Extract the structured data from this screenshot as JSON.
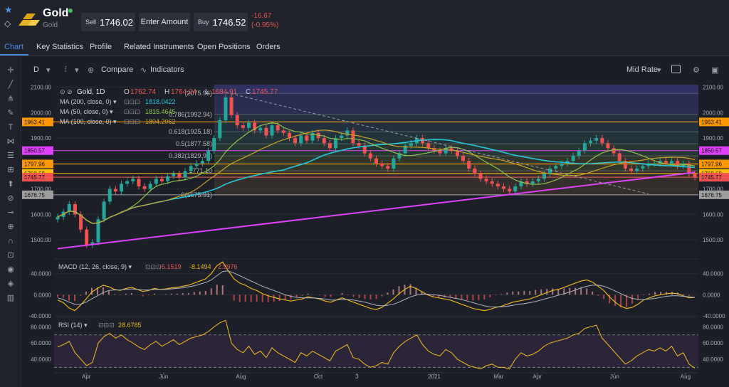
{
  "header": {
    "title": "Gold",
    "subtitle": "Gold",
    "sell_label": "Sell",
    "sell_price": "1746.02",
    "enter_amount": "Enter Amount",
    "buy_label": "Buy",
    "buy_price": "1746.52",
    "change_abs": "-16.67",
    "change_pct": "(-0.95%)"
  },
  "tabs": [
    "Chart",
    "Key Statistics",
    "Profile",
    "Related Instruments",
    "Open Positions",
    "Orders"
  ],
  "toolbar": {
    "interval": "D",
    "compare": "Compare",
    "indicators": "Indicators",
    "price_mode": "Mid Rate"
  },
  "colors": {
    "up": "#26a69a",
    "down": "#ef5350",
    "ma200": "#26c6da",
    "ma50": "#8bc34a",
    "ma100": "#c9a227",
    "trend": "#e040fb",
    "fib": "#ffffff",
    "orange_line": "#ff9800"
  },
  "chart_data": [
    {
      "type": "line",
      "title": "Gold, 1D",
      "ohlc": {
        "O": "1762.74",
        "H": "1764.24",
        "L": "1684.91",
        "C": "1745.77"
      },
      "ma": [
        {
          "name": "MA (200, close, 0)",
          "value": "1818.0422"
        },
        {
          "name": "MA (50, close, 0)",
          "value": "1815.4645"
        },
        {
          "name": "MA (100, close, 0)",
          "value": "1804.2062"
        }
      ],
      "x_ticks": [
        "Apr",
        "Jun",
        "Aug",
        "Oct",
        "3",
        "2021",
        "Mar",
        "Apr",
        "Jun",
        "Aug"
      ],
      "y_ticks": [
        "2100.00",
        "2000.00",
        "1900.00",
        "1800.00",
        "1700.00",
        "1600.00",
        "1500.00"
      ],
      "ylim": [
        1430,
        2110
      ],
      "level_labels": [
        {
          "text": "1963.41",
          "value": 1963.41,
          "color": "#ff9800"
        },
        {
          "text": "1850.57",
          "value": 1850.57,
          "color": "#e040fb"
        },
        {
          "text": "1797.96",
          "value": 1797.96,
          "color": "#ff9800"
        },
        {
          "text": "1760.69",
          "value": 1760.69,
          "color": "#ffc107"
        },
        {
          "text": "1745.77",
          "value": 1745.77,
          "color": "#ef5350"
        },
        {
          "text": "1676.75",
          "value": 1676.75,
          "color": "#9e9e9e"
        }
      ],
      "fib_levels": [
        {
          "text": "(2075.96)",
          "value": 2075.96
        },
        {
          "text": "0.786(1992.94)",
          "value": 1992.94
        },
        {
          "text": "0.618(1925.18)",
          "value": 1925.18
        },
        {
          "text": "0.5(1877.58)",
          "value": 1877.58
        },
        {
          "text": "0.382(1829.99)",
          "value": 1829.99
        },
        {
          "text": "1771.10",
          "value": 1771.1
        },
        {
          "text": "0(1675.91)",
          "value": 1675.91
        }
      ],
      "series": [
        {
          "name": "Gold",
          "values": [
            1590,
            1610,
            1640,
            1600,
            1540,
            1480,
            1490,
            1580,
            1650,
            1700,
            1690,
            1720,
            1730,
            1740,
            1710,
            1700,
            1720,
            1740,
            1730,
            1750,
            1760,
            1745,
            1770,
            1790,
            1800,
            1810,
            1850,
            1900,
            1970,
            2060,
            1990,
            1950,
            1940,
            1960,
            1930,
            1940,
            1910,
            1950,
            1930,
            1920,
            1900,
            1880,
            1910,
            1890,
            1920,
            1900,
            1880,
            1860,
            1900,
            1910,
            1930,
            1880,
            1870,
            1840,
            1820,
            1800,
            1790,
            1780,
            1820,
            1840,
            1870,
            1880,
            1900,
            1880,
            1860,
            1850,
            1840,
            1860,
            1850,
            1830,
            1810,
            1780,
            1760,
            1740,
            1730,
            1720,
            1710,
            1700,
            1690,
            1710,
            1730,
            1720,
            1730,
            1740,
            1760,
            1780,
            1790,
            1800,
            1810,
            1830,
            1850,
            1880,
            1890,
            1900,
            1880,
            1860,
            1840,
            1810,
            1780,
            1770,
            1780,
            1790,
            1800,
            1800,
            1810,
            1800,
            1810,
            1790,
            1800,
            1760,
            1745
          ]
        }
      ]
    },
    {
      "type": "line",
      "title": "MACD (12, 26, close, 9)",
      "readouts": [
        "-5.1519",
        "-8.1494",
        "2.9976"
      ],
      "y_ticks": [
        "40.0000",
        "0.0000",
        "-40.0000"
      ],
      "ylim": [
        -40,
        65
      ],
      "series": [
        {
          "name": "MACD",
          "values": [
            -10,
            -15,
            -25,
            -30,
            -20,
            -8,
            5,
            12,
            18,
            15,
            10,
            8,
            12,
            14,
            10,
            6,
            8,
            12,
            10,
            11,
            13,
            14,
            16,
            18,
            22,
            26,
            30,
            40,
            55,
            62,
            45,
            30,
            22,
            18,
            12,
            8,
            2,
            -2,
            -5,
            -8,
            -10,
            -12,
            -10,
            -8,
            -4,
            -6,
            -8,
            -12,
            -14,
            -10,
            -6,
            -10,
            -14,
            -18,
            -22,
            -26,
            -28,
            -24,
            -16,
            -8,
            2,
            10,
            16,
            12,
            6,
            0,
            -4,
            -6,
            -8,
            -10,
            -14,
            -18,
            -22,
            -26,
            -28,
            -30,
            -28,
            -24,
            -22,
            -18,
            -14,
            -12,
            -10,
            -8,
            -4,
            0,
            4,
            8,
            10,
            14,
            18,
            22,
            26,
            28,
            24,
            16,
            8,
            -4,
            -14,
            -22,
            -26,
            -24,
            -18,
            -10,
            -6,
            -2,
            0,
            2,
            3,
            2,
            -2,
            -6,
            -5
          ]
        },
        {
          "name": "Signal",
          "values": [
            -6,
            -9,
            -14,
            -18,
            -18,
            -14,
            -8,
            -2,
            4,
            8,
            9,
            9,
            10,
            11,
            10,
            9,
            9,
            10,
            10,
            10,
            11,
            12,
            13,
            15,
            17,
            20,
            23,
            28,
            36,
            44,
            45,
            41,
            36,
            31,
            26,
            21,
            16,
            12,
            8,
            4,
            0,
            -3,
            -5,
            -6,
            -6,
            -6,
            -7,
            -8,
            -10,
            -10,
            -9,
            -9,
            -10,
            -12,
            -14,
            -17,
            -20,
            -21,
            -20,
            -18,
            -14,
            -9,
            -4,
            -1,
            1,
            1,
            0,
            -1,
            -3,
            -5,
            -7,
            -9,
            -12,
            -15,
            -18,
            -21,
            -23,
            -23,
            -23,
            -22,
            -20,
            -18,
            -17,
            -15,
            -13,
            -10,
            -7,
            -4,
            -1,
            2,
            5,
            9,
            13,
            16,
            18,
            18,
            16,
            12,
            7,
            2,
            -3,
            -7,
            -9,
            -9,
            -8,
            -7,
            -5,
            -3,
            -2,
            -2,
            -3,
            -4,
            -5
          ]
        }
      ]
    },
    {
      "type": "line",
      "title": "RSI (14)",
      "readouts": [
        "28.6785"
      ],
      "y_ticks": [
        "80.0000",
        "60.0000",
        "40.0000"
      ],
      "ylim": [
        25,
        90
      ],
      "series": [
        {
          "name": "RSI",
          "values": [
            55,
            58,
            62,
            48,
            40,
            32,
            36,
            60,
            68,
            72,
            66,
            70,
            64,
            60,
            55,
            52,
            58,
            62,
            56,
            60,
            64,
            58,
            62,
            66,
            68,
            70,
            74,
            80,
            85,
            88,
            60,
            52,
            48,
            56,
            46,
            50,
            42,
            54,
            48,
            44,
            40,
            36,
            48,
            44,
            50,
            46,
            42,
            38,
            50,
            54,
            58,
            42,
            40,
            34,
            30,
            32,
            36,
            34,
            48,
            56,
            62,
            66,
            70,
            58,
            50,
            46,
            44,
            52,
            48,
            40,
            36,
            32,
            30,
            28,
            32,
            34,
            30,
            30,
            28,
            40,
            48,
            44,
            46,
            50,
            56,
            60,
            62,
            64,
            66,
            70,
            72,
            78,
            80,
            82,
            66,
            58,
            50,
            42,
            34,
            38,
            44,
            48,
            52,
            50,
            54,
            50,
            56,
            44,
            48,
            34,
            29
          ]
        }
      ]
    }
  ]
}
